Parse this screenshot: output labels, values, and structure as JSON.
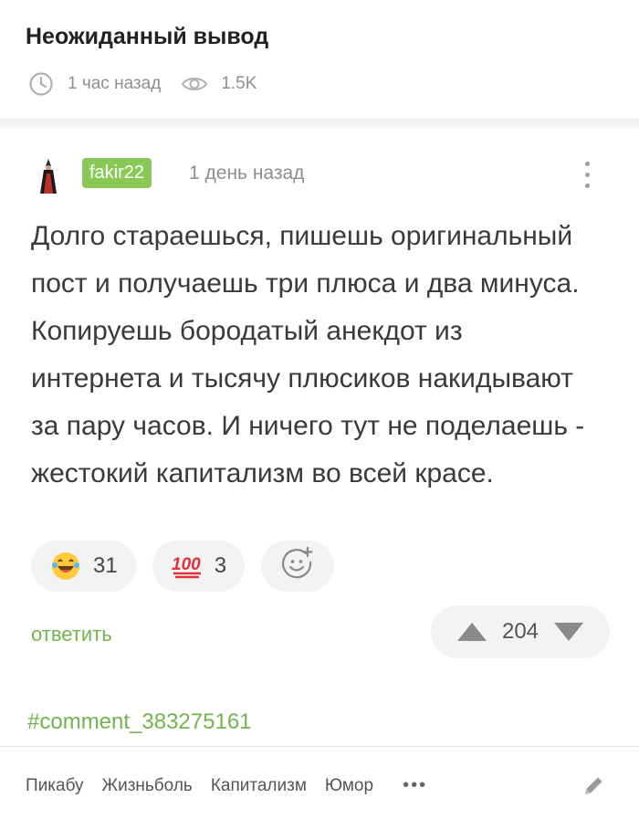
{
  "post": {
    "title": "Неожиданный вывод",
    "time_ago": "1 час назад",
    "views": "1.5K"
  },
  "comment": {
    "username": "fakir22",
    "time_ago": "1 день назад",
    "text": "Долго стараешься, пишешь оригинальный пост и получаешь три плюса и два минуса. Копируешь бородатый анекдот из интернета и тысячу плюсиков накидывают за пару часов. И ничего тут не поделаешь - жестокий капитализм во всей красе.",
    "reactions": [
      {
        "emoji": "laughing-face",
        "count": "31"
      },
      {
        "emoji": "hundred-points",
        "count": "3"
      }
    ],
    "reply_label": "ответить",
    "rating": "204",
    "anchor": "#comment_383275161"
  },
  "tags": [
    "Пикабу",
    "Жизньболь",
    "Капитализм",
    "Юмор"
  ],
  "tags_more": "•••",
  "colors": {
    "accent_green": "#72b44e",
    "badge_green": "#8ac858",
    "muted_gray": "#8e8e8e"
  }
}
